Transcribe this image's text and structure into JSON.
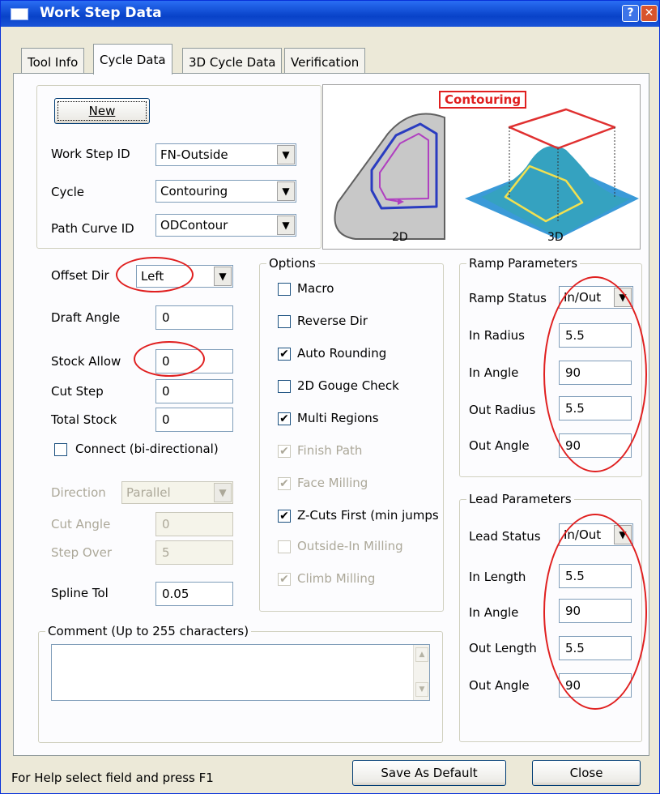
{
  "window": {
    "title": "Work Step Data",
    "help_glyph": "?",
    "close_glyph": "✕"
  },
  "tabs": [
    "Tool Info",
    "Cycle Data",
    "3D Cycle Data",
    "Verification"
  ],
  "top": {
    "new_button": "New",
    "work_step_id": {
      "label": "Work Step ID",
      "value": "FN-Outside"
    },
    "cycle": {
      "label": "Cycle",
      "value": "Contouring"
    },
    "path_curve_id": {
      "label": "Path Curve ID",
      "value": "ODContour"
    }
  },
  "preview": {
    "title": "Contouring",
    "label_2d": "2D",
    "label_3d": "3D"
  },
  "left": {
    "offset_dir": {
      "label": "Offset Dir",
      "value": "Left"
    },
    "draft_angle": {
      "label": "Draft Angle",
      "value": "0"
    },
    "stock_allow": {
      "label": "Stock Allow",
      "value": "0"
    },
    "cut_step": {
      "label": "Cut Step",
      "value": "0"
    },
    "total_stock": {
      "label": "Total Stock",
      "value": "0"
    },
    "connect": {
      "label": "Connect (bi-directional)",
      "checked": false
    },
    "direction": {
      "label": "Direction",
      "value": "Parallel"
    },
    "cut_angle": {
      "label": "Cut Angle",
      "value": "0"
    },
    "step_over": {
      "label": "Step Over",
      "value": "5"
    },
    "spline_tol": {
      "label": "Spline Tol",
      "value": "0.05"
    }
  },
  "options": {
    "title": "Options",
    "items": [
      {
        "label": "Macro",
        "checked": false,
        "enabled": true
      },
      {
        "label": "Reverse Dir",
        "checked": false,
        "enabled": true
      },
      {
        "label": "Auto Rounding",
        "checked": true,
        "enabled": true
      },
      {
        "label": "2D Gouge Check",
        "checked": false,
        "enabled": true
      },
      {
        "label": "Multi Regions",
        "checked": true,
        "enabled": true
      },
      {
        "label": "Finish Path",
        "checked": true,
        "enabled": false
      },
      {
        "label": "Face Milling",
        "checked": true,
        "enabled": false
      },
      {
        "label": "Z-Cuts First (min jumps",
        "checked": true,
        "enabled": true
      },
      {
        "label": "Outside-In Milling",
        "checked": false,
        "enabled": false
      },
      {
        "label": "Climb Milling",
        "checked": true,
        "enabled": false
      }
    ]
  },
  "ramp": {
    "title": "Ramp Parameters",
    "status": {
      "label": "Ramp Status",
      "value": "In/Out"
    },
    "in_radius": {
      "label": "In Radius",
      "value": "5.5"
    },
    "in_angle": {
      "label": "In Angle",
      "value": "90"
    },
    "out_radius": {
      "label": "Out Radius",
      "value": "5.5"
    },
    "out_angle": {
      "label": "Out Angle",
      "value": "90"
    }
  },
  "lead": {
    "title": "Lead Parameters",
    "status": {
      "label": "Lead Status",
      "value": "In/Out"
    },
    "in_length": {
      "label": "In Length",
      "value": "5.5"
    },
    "in_angle": {
      "label": "In Angle",
      "value": "90"
    },
    "out_length": {
      "label": "Out Length",
      "value": "5.5"
    },
    "out_angle": {
      "label": "Out Angle",
      "value": "90"
    }
  },
  "comment": {
    "title": "Comment  (Up to 255 characters)",
    "value": ""
  },
  "footer": {
    "help_text": "For Help select field and press F1",
    "save_default": "Save As Default",
    "close": "Close"
  },
  "colors": {
    "annotation": "#e02020",
    "titlebar": "#0842c8",
    "dialog": "#ece9d8"
  }
}
